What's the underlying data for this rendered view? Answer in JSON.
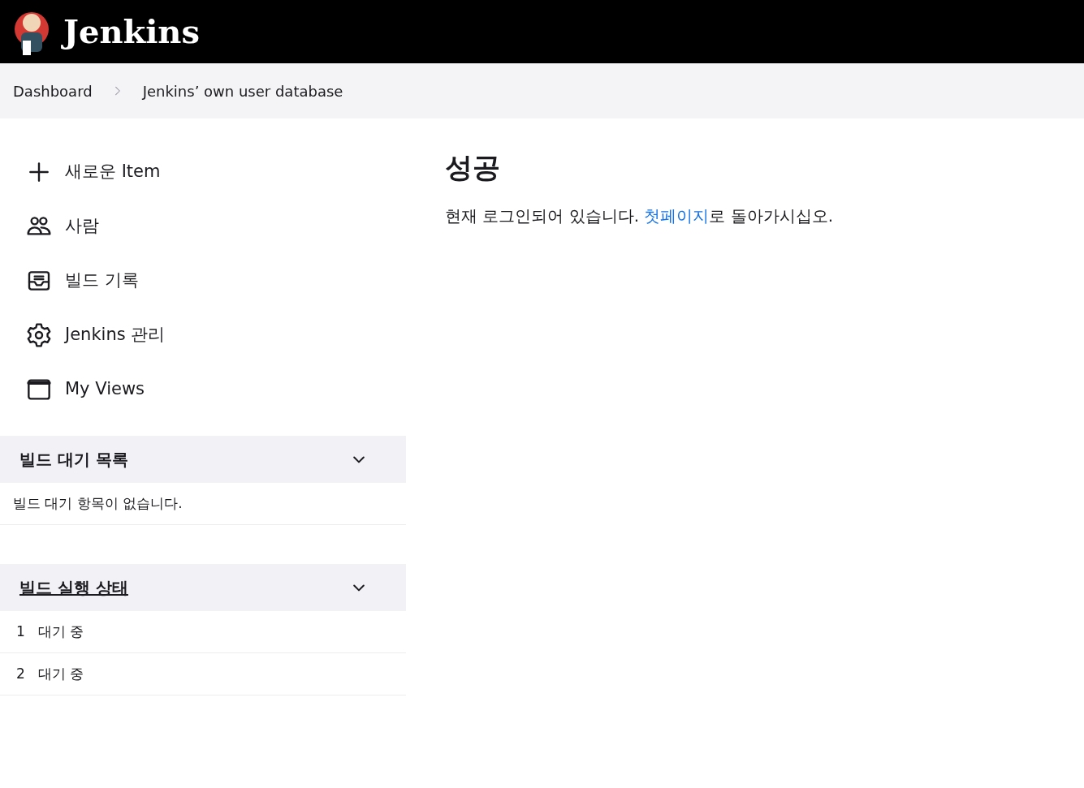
{
  "header": {
    "title": "Jenkins"
  },
  "breadcrumbs": [
    {
      "label": "Dashboard"
    },
    {
      "label": "Jenkins’ own user database"
    }
  ],
  "sidebar": {
    "items": [
      {
        "kind": "plus",
        "label": "새로운 Item"
      },
      {
        "kind": "people",
        "label": "사람"
      },
      {
        "kind": "inbox",
        "label": "빌드 기록"
      },
      {
        "kind": "gear",
        "label": "Jenkins 관리"
      },
      {
        "kind": "window",
        "label": "My Views"
      }
    ]
  },
  "panels": [
    {
      "title": "빌드 대기 목록",
      "underlined": false,
      "expanded": true,
      "rows": [
        {
          "text": "빌드 대기 항목이 없습니다."
        }
      ]
    },
    {
      "title": "빌드 실행 상태",
      "underlined": true,
      "expanded": true,
      "rows": [
        {
          "number": "1",
          "text": "대기 중"
        },
        {
          "number": "2",
          "text": "대기 중"
        }
      ]
    }
  ],
  "main": {
    "heading": "성공",
    "message": {
      "before": "현재 로그인되어 있습니다. ",
      "link": "첫페이지",
      "after": "로 돌아가시십오."
    }
  }
}
